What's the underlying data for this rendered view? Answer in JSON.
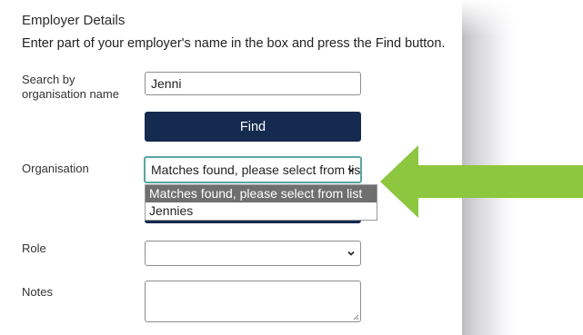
{
  "form": {
    "heading": "Employer Details",
    "instruction": "Enter part of your employer's name in the box and press the Find button.",
    "search_label_line1": "Search by",
    "search_label_line2": "organisation name",
    "search_value": "Jenni",
    "find_label": "Find",
    "organisation_label": "Organisation",
    "organisation_selected": "Matches found, please select from list",
    "organisation_options": [
      "Matches found, please select from list",
      "Jennies"
    ],
    "role_label": "Role",
    "role_value": "",
    "notes_label": "Notes",
    "notes_value": ""
  },
  "colors": {
    "button_bg": "#142a4e",
    "focus_border": "#5aa6a0",
    "highlight_option": "#6f6f6f",
    "annotation_arrow": "#8dc63f"
  },
  "icons": {
    "select_chevron": "chevron-down-icon",
    "resize_grip": "resize-grip-icon",
    "annotation": "arrow-left-icon"
  }
}
